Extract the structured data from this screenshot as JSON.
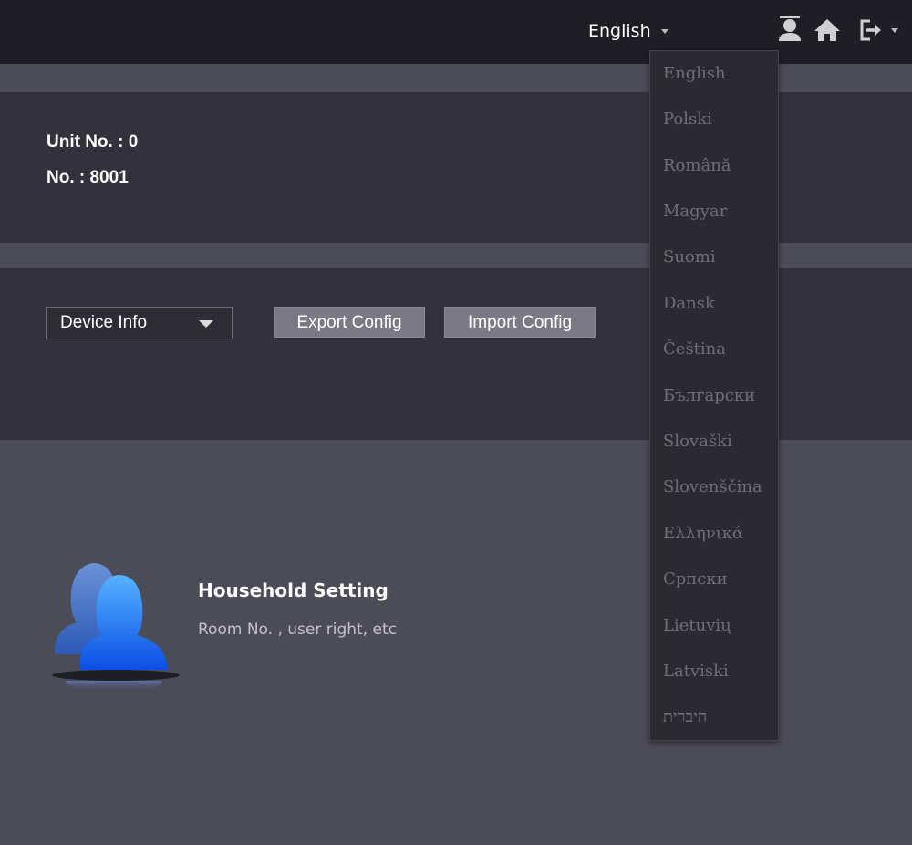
{
  "header": {
    "language_label": "English",
    "icons": [
      "user-icon",
      "home-icon",
      "logout-icon"
    ]
  },
  "unit_info": {
    "unit_line": "Unit No. : 0",
    "no_line": "No. : 8001"
  },
  "config": {
    "select_value": "Device Info",
    "export_label": "Export Config",
    "import_label": "Import Config"
  },
  "household": {
    "title": "Household Setting",
    "description": "Room No. , user right, etc"
  },
  "language_dropdown": {
    "items": [
      "English",
      "Polski",
      "Română",
      "Magyar",
      "Suomi",
      "Dansk",
      "Čeština",
      "Български",
      "Slovaški",
      "Slovenščina",
      "Ελληνικά",
      "Српски",
      "Lietuvių",
      "Latviski",
      "היברית"
    ]
  },
  "colors": {
    "background": "#4c4b58",
    "topbar": "#1f1e25",
    "panel": "#33323c",
    "dropdown_bg": "#2b2a31",
    "dropdown_text": "#6f6e78",
    "button": "#7a7985",
    "accent_blue": "#1f6ff0"
  }
}
